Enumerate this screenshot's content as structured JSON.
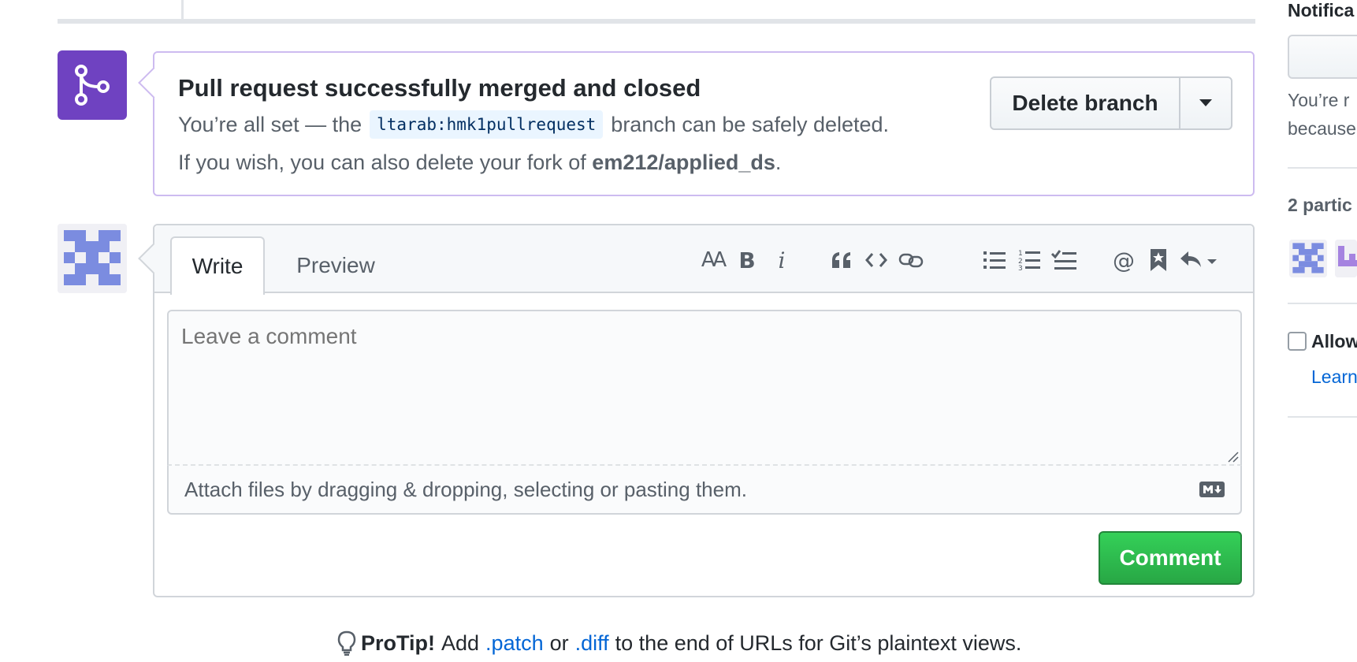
{
  "merge": {
    "title": "Pull request successfully merged and closed",
    "line1_prefix": "You’re all set — the",
    "branch": "ltarab:hmk1pullrequest",
    "line1_suffix": "branch can be safely deleted.",
    "line2_prefix": "If you wish, you can also delete your fork of",
    "fork_name": "em212/applied_ds",
    "line2_suffix": ".",
    "delete_button": "Delete branch",
    "badge_color": "#6f42c1"
  },
  "comment_form": {
    "tabs": [
      "Write",
      "Preview"
    ],
    "toolbar_text": {
      "heading": "AA",
      "bold": "B",
      "italic": "i"
    },
    "toolbar_icons": [
      "quote-icon",
      "code-icon",
      "link-icon",
      "unordered-list-icon",
      "ordered-list-icon",
      "task-list-icon",
      "mention-icon",
      "reference-icon",
      "saved-reply-icon"
    ],
    "placeholder": "Leave a comment",
    "attach_text": "Attach files by dragging & dropping, selecting or pasting them.",
    "submit_label": "Comment",
    "submit_color": "#28a745"
  },
  "protip": {
    "label": "ProTip!",
    "text1": "Add",
    "patch": ".patch",
    "text2": "or",
    "diff": ".diff",
    "text3": "to the end of URLs for Git’s plaintext views."
  },
  "sidebar": {
    "notifications_title": "Notifica",
    "reason_line1": "You’re r",
    "reason_line2": "because",
    "participants_title": "2 partic",
    "allow_label": "Allow",
    "learn_link": "Learn"
  }
}
